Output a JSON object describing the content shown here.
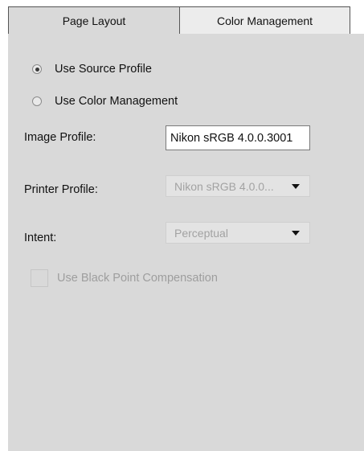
{
  "tabs": [
    {
      "label": "Page Layout",
      "active": false
    },
    {
      "label": "Color Management",
      "active": true
    }
  ],
  "profile_source": {
    "options": [
      {
        "label": "Use Source Profile",
        "checked": true
      },
      {
        "label": "Use Color Management",
        "checked": false
      }
    ]
  },
  "fields": {
    "image_profile": {
      "label": "Image Profile:",
      "value": "Nikon sRGB 4.0.0.3001"
    },
    "printer_profile": {
      "label": "Printer Profile:",
      "value": "Nikon sRGB 4.0.0...",
      "enabled": false
    },
    "intent": {
      "label": "Intent:",
      "value": "Perceptual",
      "enabled": false
    }
  },
  "black_point": {
    "label": "Use Black Point Compensation",
    "checked": false,
    "enabled": false
  },
  "colors": {
    "panel_bg": "#d9d9d9",
    "active_tab_bg": "#ececec",
    "disabled_text": "#a2a2a2"
  }
}
